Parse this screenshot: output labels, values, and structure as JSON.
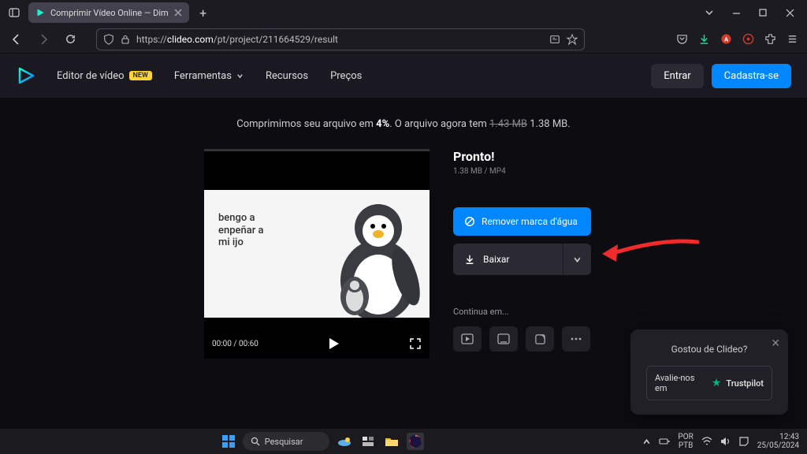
{
  "browser": {
    "tab_title": "Comprimir Vídeo Online — Dim",
    "url_prefix": "https://",
    "url_domain": "clideo.com",
    "url_path": "/pt/project/211664529/result"
  },
  "header": {
    "nav": {
      "editor": "Editor de vídeo",
      "new_badge": "NEW",
      "ferramentas": "Ferramentas",
      "recursos": "Recursos",
      "precos": "Preços"
    },
    "entrar": "Entrar",
    "cadastra": "Cadastra-se"
  },
  "status": {
    "prefix": "Comprimimos seu arquivo em ",
    "percent": "4%",
    "middle": ". O arquivo agora tem ",
    "old_size": "1.43 MB",
    "new_size": " 1.38 MB."
  },
  "video": {
    "meme_line1": "bengo a",
    "meme_line2": "enpeñar a",
    "meme_line3": "mi ijo",
    "current_time": "00:00",
    "sep": " / ",
    "duration": "00:60"
  },
  "panel": {
    "ready": "Pronto!",
    "meta": "1.38 MB  /  MP4",
    "watermark": "Remover marca d'água",
    "download": "Baixar",
    "continue": "Continua em..."
  },
  "trustpilot": {
    "title": "Gostou de Clideo?",
    "btn_prefix": "Avalie-nos em ",
    "brand": "Trustpilot"
  },
  "taskbar": {
    "search": "Pesquisar",
    "lang1": "POR",
    "lang2": "PTB",
    "time": "12:43",
    "date": "25/05/2024"
  }
}
